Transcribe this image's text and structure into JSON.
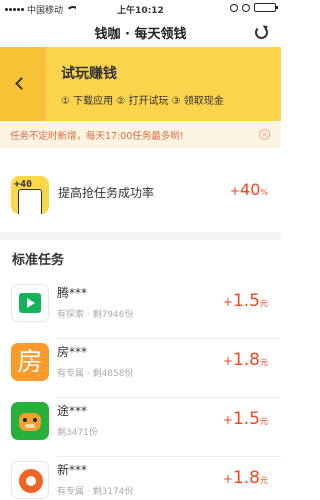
{
  "status_bar": {
    "carrier": "中国移动",
    "time": "上午10:12"
  },
  "nav": {
    "title": "钱咖 · 每天领钱",
    "refresh_icon": "refresh-icon"
  },
  "banner": {
    "title": "试玩赚钱",
    "steps": "① 下载应用  ② 打开试玩  ③ 领取现金",
    "back_icon": "chevron-left-icon",
    "colors": {
      "background": "#fbd34c",
      "back_tab": "#f7c236"
    }
  },
  "notice": {
    "text": "任务不定时新增，每天17:00任务最多哟!",
    "close_icon": "close-circle-icon"
  },
  "promo": {
    "icon_badge": "+40",
    "label": "提高抢任务成功率",
    "value_plus": "+",
    "value": "40",
    "unit": "%"
  },
  "section_title": "标准任务",
  "accent_color": "#f3481f",
  "tasks": [
    {
      "name": "腾***",
      "meta": "有探索 · 剩7946份",
      "plus": "+",
      "value": "1.5",
      "unit": "元",
      "icon": "tencent-video-icon"
    },
    {
      "name": "房***",
      "meta": "有专属 · 剩4858份",
      "plus": "+",
      "value": "1.8",
      "unit": "元",
      "icon": "fang-app-icon",
      "icon_char": "房"
    },
    {
      "name": "途***",
      "meta": "剩3471份",
      "plus": "+",
      "value": "1.5",
      "unit": "元",
      "icon": "tuniu-app-icon"
    },
    {
      "name": "新***",
      "meta": "有专属 · 剩3174份",
      "plus": "+",
      "value": "1.8",
      "unit": "元",
      "icon": "xin-app-icon"
    }
  ]
}
